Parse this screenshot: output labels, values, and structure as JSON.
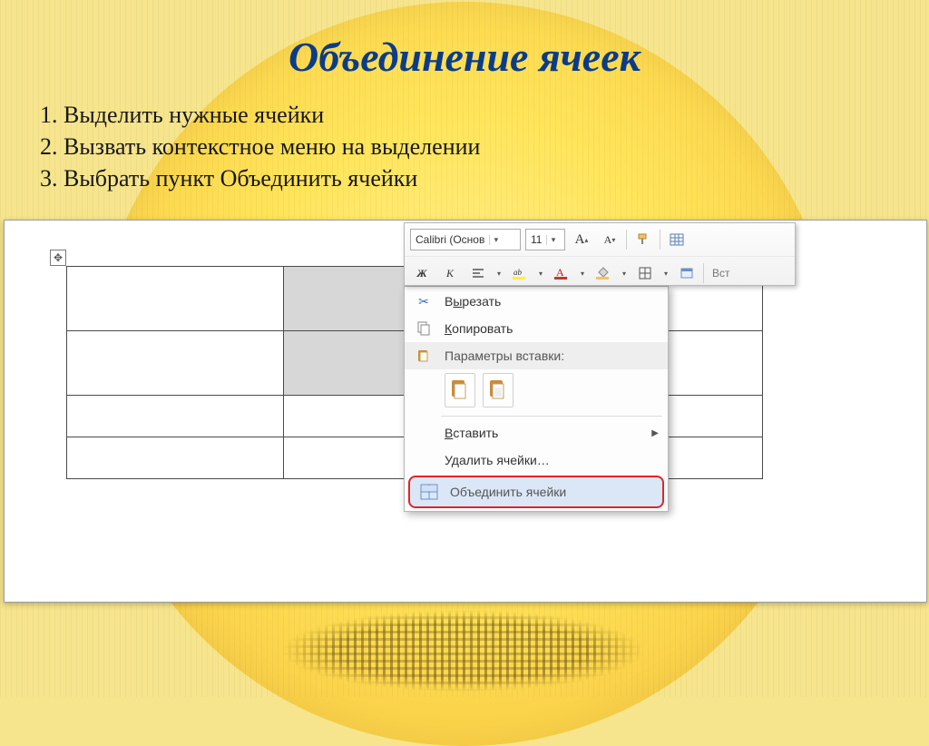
{
  "slide": {
    "title": "Объединение ячеек",
    "steps": [
      "Выделить нужные ячейки",
      "Вызвать контекстное меню на выделении",
      "Выбрать пункт Объединить ячейки"
    ]
  },
  "mini_toolbar": {
    "font_name": "Calibri (Основ",
    "font_size": "11",
    "grow_font_label": "A",
    "shrink_font_label": "A",
    "bold_label": "Ж",
    "italic_label": "К",
    "insert_hint": "Вст"
  },
  "context_menu": {
    "cut": "Вырезать",
    "cut_ul": "ы",
    "copy": "Копировать",
    "copy_ul": "К",
    "paste_header": "Параметры вставки:",
    "insert": "Вставить",
    "insert_ul": "В",
    "delete_cells": "Удалить ячейки…",
    "merge_cells": "Объединить ячейки"
  },
  "icons": {
    "move": "✥",
    "dropdown": "▾",
    "scissors": "✂",
    "submenu": "▶"
  }
}
